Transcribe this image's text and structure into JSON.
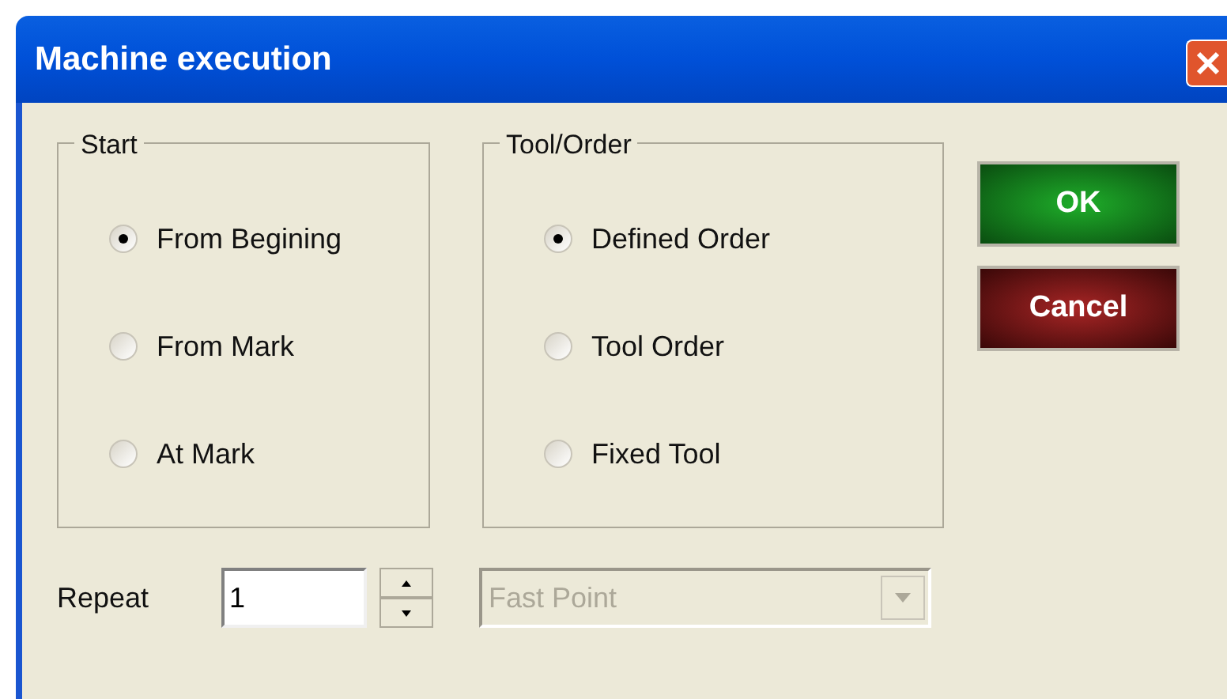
{
  "window": {
    "title": "Machine execution"
  },
  "groups": [
    {
      "title": "Start",
      "options": [
        {
          "label": "From Begining",
          "selected": true
        },
        {
          "label": "From Mark",
          "selected": false
        },
        {
          "label": "At Mark",
          "selected": false
        }
      ]
    },
    {
      "title": "Tool/Order",
      "options": [
        {
          "label": "Defined Order",
          "selected": true
        },
        {
          "label": "Tool Order",
          "selected": false
        },
        {
          "label": "Fixed Tool",
          "selected": false
        }
      ]
    }
  ],
  "buttons": [
    {
      "label": "OK",
      "kind": "ok"
    },
    {
      "label": "Cancel",
      "kind": "cancel"
    }
  ],
  "repeat": {
    "label": "Repeat",
    "value": "1"
  },
  "tool_select": {
    "value": "Fast Point",
    "disabled": true
  }
}
